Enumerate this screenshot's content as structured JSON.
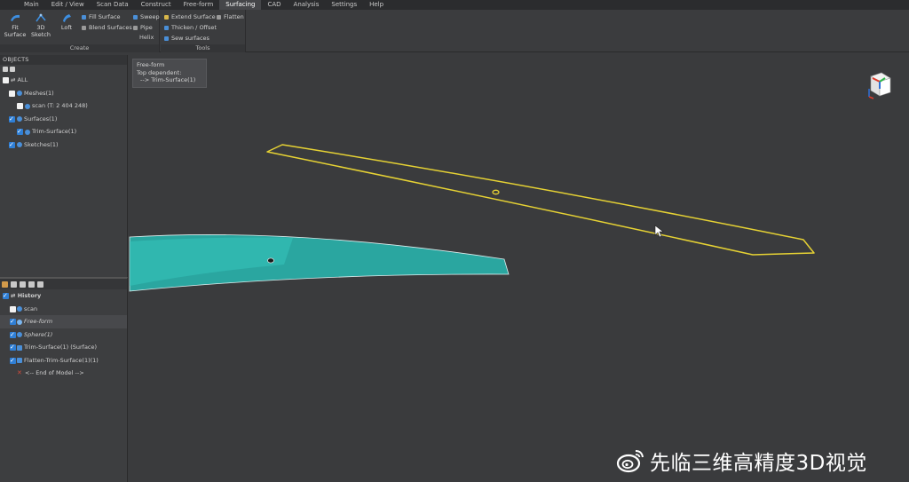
{
  "menubar": {
    "items": [
      "Main",
      "Edit / View",
      "Scan Data",
      "Construct",
      "Free-form",
      "Surfacing",
      "CAD",
      "Analysis",
      "Settings",
      "Help"
    ],
    "active": "Surfacing"
  },
  "ribbon": {
    "create": {
      "title": "Create",
      "fit_surface": "Fit\nSurface",
      "fit_surface_l1": "Fit",
      "fit_surface_l2": "Surface",
      "sketch_l1": "3D",
      "sketch_l2": "Sketch",
      "loft": "Loft",
      "fill_surface": "Fill Surface",
      "blend_surfaces": "Blend Surfaces",
      "sweep": "Sweep",
      "pipe": "Pipe",
      "helix": "Helix"
    },
    "tools": {
      "title": "Tools",
      "extend_surface": "Extend Surface",
      "flatten": "Flatten",
      "thicken_offset": "Thicken / Offset",
      "sew_surfaces": "Sew surfaces"
    }
  },
  "objects": {
    "header": "OBJECTS",
    "rows": [
      {
        "label": "ALL",
        "checked": false
      },
      {
        "label": "Meshes(1)",
        "checked": false
      },
      {
        "label": "scan (T: 2 404 248)",
        "checked": false
      },
      {
        "label": "Surfaces(1)",
        "checked": true
      },
      {
        "label": "Trim-Surface(1)",
        "checked": true
      },
      {
        "label": "Sketches(1)",
        "checked": true
      }
    ]
  },
  "history": {
    "rows": [
      {
        "label": "History",
        "checked": true
      },
      {
        "label": "scan",
        "checked": false
      },
      {
        "label": "Free-form",
        "checked": true
      },
      {
        "label": "Sphere(1)",
        "checked": true
      },
      {
        "label": "Trim-Surface(1) (Surface)",
        "checked": true
      },
      {
        "label": "Flatten-Trim-Surface(1)(1)",
        "checked": true
      },
      {
        "label": "<-- End of Model -->",
        "checked": false
      }
    ]
  },
  "viewport": {
    "info": {
      "line1": "Free-form",
      "line2": "Top dependent:",
      "line3": "--> Trim-Surface(1)"
    },
    "colors": {
      "surface": "#2fb3aa",
      "outline": "#e6d234"
    }
  },
  "watermark": {
    "text": "先临三维高精度3D视觉"
  }
}
